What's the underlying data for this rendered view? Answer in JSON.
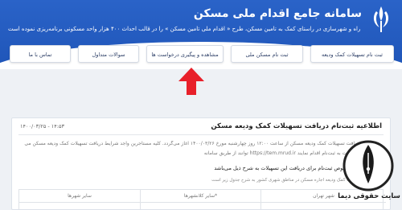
{
  "header": {
    "title": "سامانه جامع اقدام ملی مسکن",
    "subtitle": "وزارت راه و شهرسازی در راستای کمک به تأمین مسکن، طرح « اقدام ملی تأمین مسکن » را در قالب احداث ۴۰۰ هزار واحد مسکونی برنامه‌ریزی نموده است"
  },
  "nav": {
    "items": [
      {
        "label": "ثبت نام تسهیلات کمک ودیعه"
      },
      {
        "label": "ثبت نام مسکن ملی"
      },
      {
        "label": "مشاهده و پیگیری درخواست ها"
      },
      {
        "label": "سوالات متداول"
      },
      {
        "label": "تماس با ما"
      }
    ]
  },
  "announcement": {
    "date": "۱۴۰۰/۰۳/۲۵ - ۱۴:۵۳",
    "title": "اطلاعیه ثبت‌نام دریافت تسهیلات کمک ودیعه مسکن",
    "line1": "ثبت‌نام دریافت تسهیلات کمک ودیعه مسکن از ساعت ۱۲:۰۰ روز چهارشنبه مورخ ۱۴۰۰/۰۳/۲۶ آغاز می‌گردد. کلیه مستاجرین واجد شرایط دریافت تسهیلات کمک ودیعه مسکن می",
    "line2": "توانند از طریق سامانه https://tem.mrud.ir مراجعه و نسبت به ثبت‌نام اقدام نمایند.",
    "bullet": "تکات مهم در خصوص ثبت‌نام برای دریافت این تسهیلات به شرح ذیل می‌باشد:",
    "note": "سقف تسهیلات کمک ودیعه اجاره مسکن در مناطق شهری کشور به شرح جدول زیر است:"
  },
  "table": {
    "row1": [
      "سایر شهرها",
      "سایر کلانشهرها*",
      "شهر تهران"
    ],
    "row2": [
      "",
      "",
      ""
    ]
  },
  "watermark": {
    "text": "سایت حقوقی دیما"
  },
  "colors": {
    "header_blue": "#2a63c8",
    "arrow_red": "#e8202a"
  }
}
